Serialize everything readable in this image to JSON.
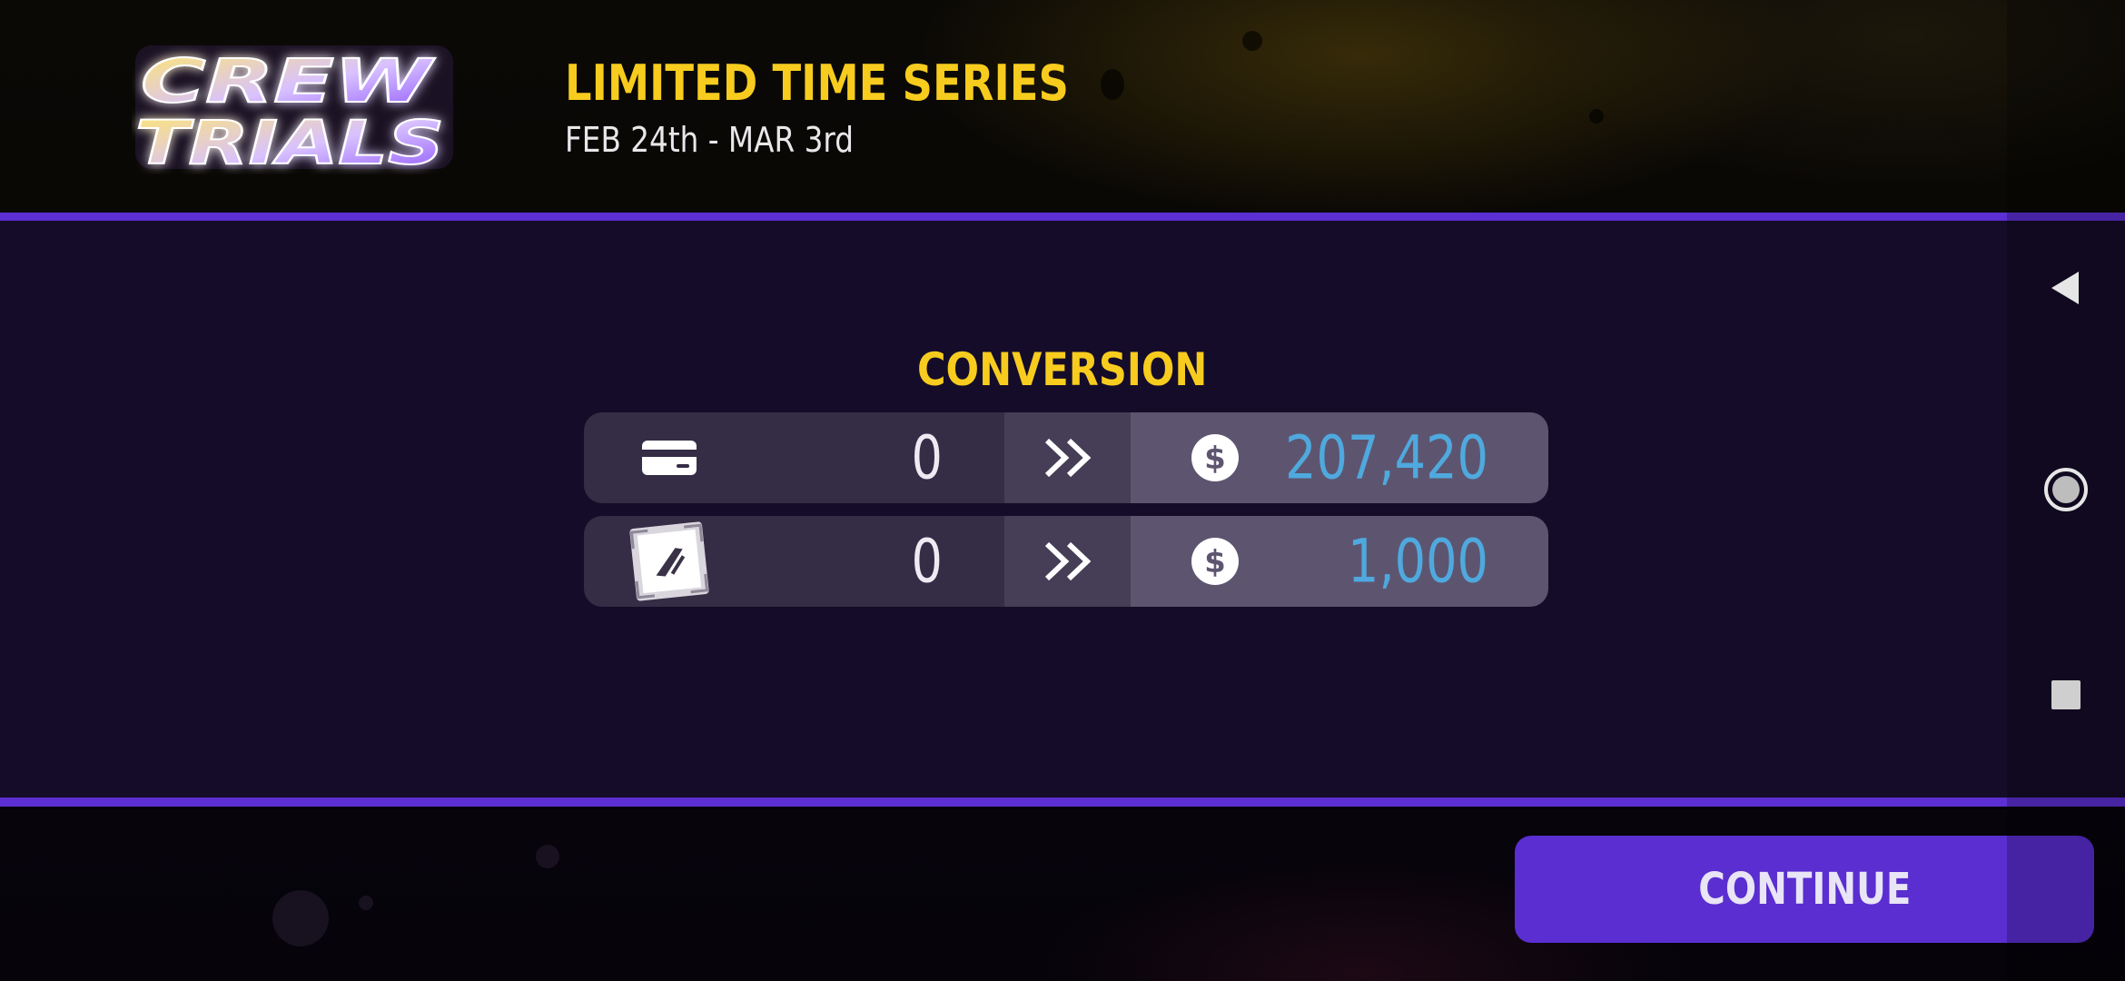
{
  "header": {
    "logo_text": "CREW TRIALS",
    "event_title": "LIMITED TIME SERIES",
    "event_dates": "FEB 24th - MAR 3rd"
  },
  "conversion": {
    "title": "CONVERSION",
    "rows": [
      {
        "source_icon": "card-icon",
        "source_value": "0",
        "arrow_icon": "double-chevron-right-icon",
        "target_icon": "dollar-coin-icon",
        "target_value": "207,420"
      },
      {
        "source_icon": "token-badge-icon",
        "source_value": "0",
        "arrow_icon": "double-chevron-right-icon",
        "target_icon": "dollar-coin-icon",
        "target_value": "1,000"
      }
    ]
  },
  "footer": {
    "continue_label": "CONTINUE"
  },
  "system_nav": {
    "buttons": [
      "back-icon",
      "home-icon",
      "recents-icon"
    ]
  },
  "colors": {
    "accent_purple": "#5b2fd2",
    "title_yellow": "#f7cc1e",
    "value_blue": "#4fa9de",
    "panel_bg": "#150c29"
  }
}
